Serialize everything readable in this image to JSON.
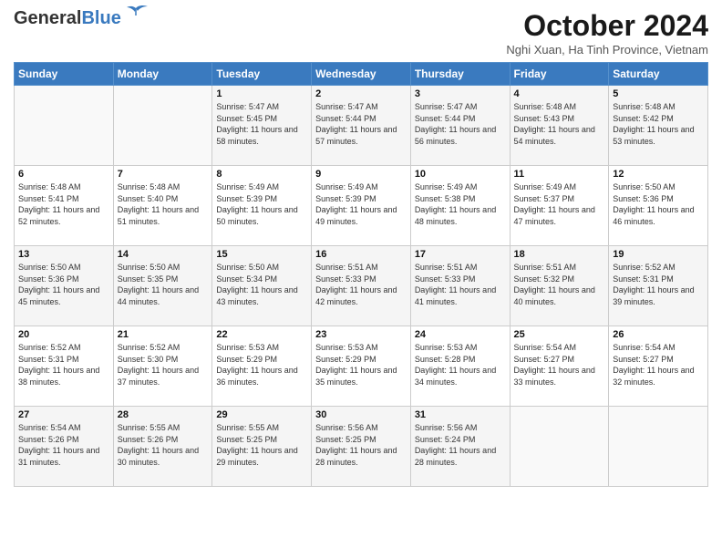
{
  "header": {
    "logo_general": "General",
    "logo_blue": "Blue",
    "month_title": "October 2024",
    "location": "Nghi Xuan, Ha Tinh Province, Vietnam"
  },
  "weekdays": [
    "Sunday",
    "Monday",
    "Tuesday",
    "Wednesday",
    "Thursday",
    "Friday",
    "Saturday"
  ],
  "weeks": [
    [
      {
        "day": "",
        "sunrise": "",
        "sunset": "",
        "daylight": ""
      },
      {
        "day": "",
        "sunrise": "",
        "sunset": "",
        "daylight": ""
      },
      {
        "day": "1",
        "sunrise": "Sunrise: 5:47 AM",
        "sunset": "Sunset: 5:45 PM",
        "daylight": "Daylight: 11 hours and 58 minutes."
      },
      {
        "day": "2",
        "sunrise": "Sunrise: 5:47 AM",
        "sunset": "Sunset: 5:44 PM",
        "daylight": "Daylight: 11 hours and 57 minutes."
      },
      {
        "day": "3",
        "sunrise": "Sunrise: 5:47 AM",
        "sunset": "Sunset: 5:44 PM",
        "daylight": "Daylight: 11 hours and 56 minutes."
      },
      {
        "day": "4",
        "sunrise": "Sunrise: 5:48 AM",
        "sunset": "Sunset: 5:43 PM",
        "daylight": "Daylight: 11 hours and 54 minutes."
      },
      {
        "day": "5",
        "sunrise": "Sunrise: 5:48 AM",
        "sunset": "Sunset: 5:42 PM",
        "daylight": "Daylight: 11 hours and 53 minutes."
      }
    ],
    [
      {
        "day": "6",
        "sunrise": "Sunrise: 5:48 AM",
        "sunset": "Sunset: 5:41 PM",
        "daylight": "Daylight: 11 hours and 52 minutes."
      },
      {
        "day": "7",
        "sunrise": "Sunrise: 5:48 AM",
        "sunset": "Sunset: 5:40 PM",
        "daylight": "Daylight: 11 hours and 51 minutes."
      },
      {
        "day": "8",
        "sunrise": "Sunrise: 5:49 AM",
        "sunset": "Sunset: 5:39 PM",
        "daylight": "Daylight: 11 hours and 50 minutes."
      },
      {
        "day": "9",
        "sunrise": "Sunrise: 5:49 AM",
        "sunset": "Sunset: 5:39 PM",
        "daylight": "Daylight: 11 hours and 49 minutes."
      },
      {
        "day": "10",
        "sunrise": "Sunrise: 5:49 AM",
        "sunset": "Sunset: 5:38 PM",
        "daylight": "Daylight: 11 hours and 48 minutes."
      },
      {
        "day": "11",
        "sunrise": "Sunrise: 5:49 AM",
        "sunset": "Sunset: 5:37 PM",
        "daylight": "Daylight: 11 hours and 47 minutes."
      },
      {
        "day": "12",
        "sunrise": "Sunrise: 5:50 AM",
        "sunset": "Sunset: 5:36 PM",
        "daylight": "Daylight: 11 hours and 46 minutes."
      }
    ],
    [
      {
        "day": "13",
        "sunrise": "Sunrise: 5:50 AM",
        "sunset": "Sunset: 5:36 PM",
        "daylight": "Daylight: 11 hours and 45 minutes."
      },
      {
        "day": "14",
        "sunrise": "Sunrise: 5:50 AM",
        "sunset": "Sunset: 5:35 PM",
        "daylight": "Daylight: 11 hours and 44 minutes."
      },
      {
        "day": "15",
        "sunrise": "Sunrise: 5:50 AM",
        "sunset": "Sunset: 5:34 PM",
        "daylight": "Daylight: 11 hours and 43 minutes."
      },
      {
        "day": "16",
        "sunrise": "Sunrise: 5:51 AM",
        "sunset": "Sunset: 5:33 PM",
        "daylight": "Daylight: 11 hours and 42 minutes."
      },
      {
        "day": "17",
        "sunrise": "Sunrise: 5:51 AM",
        "sunset": "Sunset: 5:33 PM",
        "daylight": "Daylight: 11 hours and 41 minutes."
      },
      {
        "day": "18",
        "sunrise": "Sunrise: 5:51 AM",
        "sunset": "Sunset: 5:32 PM",
        "daylight": "Daylight: 11 hours and 40 minutes."
      },
      {
        "day": "19",
        "sunrise": "Sunrise: 5:52 AM",
        "sunset": "Sunset: 5:31 PM",
        "daylight": "Daylight: 11 hours and 39 minutes."
      }
    ],
    [
      {
        "day": "20",
        "sunrise": "Sunrise: 5:52 AM",
        "sunset": "Sunset: 5:31 PM",
        "daylight": "Daylight: 11 hours and 38 minutes."
      },
      {
        "day": "21",
        "sunrise": "Sunrise: 5:52 AM",
        "sunset": "Sunset: 5:30 PM",
        "daylight": "Daylight: 11 hours and 37 minutes."
      },
      {
        "day": "22",
        "sunrise": "Sunrise: 5:53 AM",
        "sunset": "Sunset: 5:29 PM",
        "daylight": "Daylight: 11 hours and 36 minutes."
      },
      {
        "day": "23",
        "sunrise": "Sunrise: 5:53 AM",
        "sunset": "Sunset: 5:29 PM",
        "daylight": "Daylight: 11 hours and 35 minutes."
      },
      {
        "day": "24",
        "sunrise": "Sunrise: 5:53 AM",
        "sunset": "Sunset: 5:28 PM",
        "daylight": "Daylight: 11 hours and 34 minutes."
      },
      {
        "day": "25",
        "sunrise": "Sunrise: 5:54 AM",
        "sunset": "Sunset: 5:27 PM",
        "daylight": "Daylight: 11 hours and 33 minutes."
      },
      {
        "day": "26",
        "sunrise": "Sunrise: 5:54 AM",
        "sunset": "Sunset: 5:27 PM",
        "daylight": "Daylight: 11 hours and 32 minutes."
      }
    ],
    [
      {
        "day": "27",
        "sunrise": "Sunrise: 5:54 AM",
        "sunset": "Sunset: 5:26 PM",
        "daylight": "Daylight: 11 hours and 31 minutes."
      },
      {
        "day": "28",
        "sunrise": "Sunrise: 5:55 AM",
        "sunset": "Sunset: 5:26 PM",
        "daylight": "Daylight: 11 hours and 30 minutes."
      },
      {
        "day": "29",
        "sunrise": "Sunrise: 5:55 AM",
        "sunset": "Sunset: 5:25 PM",
        "daylight": "Daylight: 11 hours and 29 minutes."
      },
      {
        "day": "30",
        "sunrise": "Sunrise: 5:56 AM",
        "sunset": "Sunset: 5:25 PM",
        "daylight": "Daylight: 11 hours and 28 minutes."
      },
      {
        "day": "31",
        "sunrise": "Sunrise: 5:56 AM",
        "sunset": "Sunset: 5:24 PM",
        "daylight": "Daylight: 11 hours and 28 minutes."
      },
      {
        "day": "",
        "sunrise": "",
        "sunset": "",
        "daylight": ""
      },
      {
        "day": "",
        "sunrise": "",
        "sunset": "",
        "daylight": ""
      }
    ]
  ]
}
